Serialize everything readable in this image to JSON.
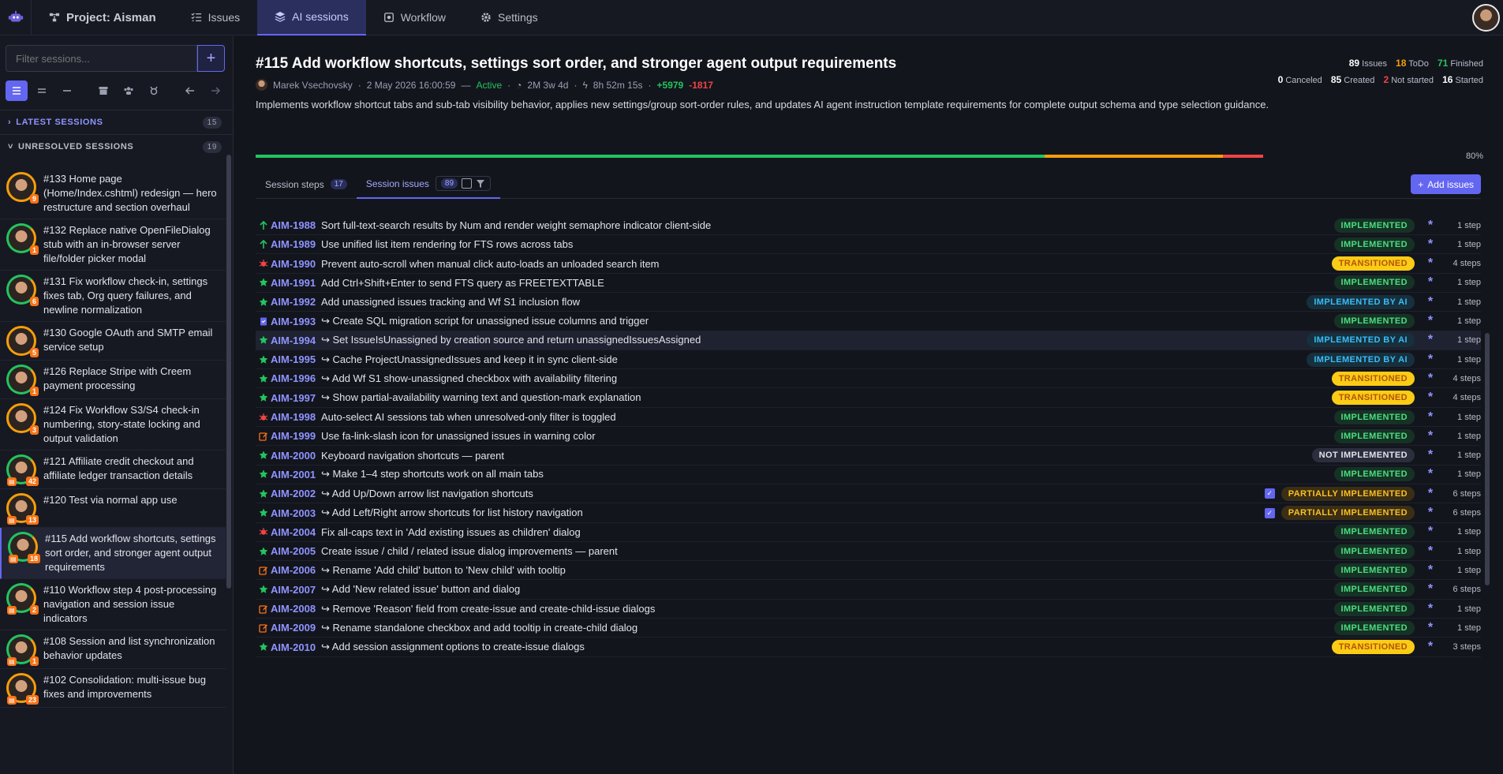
{
  "nav": {
    "project": "Project: Aisman",
    "issues": "Issues",
    "ai_sessions": "AI sessions",
    "workflow": "Workflow",
    "settings": "Settings"
  },
  "sidebar": {
    "filter_placeholder": "Filter sessions...",
    "add": "+",
    "latest_label": "LATEST SESSIONS",
    "latest_count": "15",
    "unresolved_label": "UNRESOLVED SESSIONS",
    "unresolved_count": "19",
    "sessions": [
      {
        "title": "#133 Home page (Home/Index.cshtml) redesign — hero restructure and section overhaul",
        "badge": "9"
      },
      {
        "title": "#132 Replace native OpenFileDialog stub with an in-browser server file/folder picker modal",
        "badge": "1"
      },
      {
        "title": "#131 Fix workflow check-in, settings fixes tab, Org query failures, and newline normalization",
        "badge": "6"
      },
      {
        "title": "#130 Google OAuth and SMTP email service setup",
        "badge": "5"
      },
      {
        "title": "#126 Replace Stripe with Creem payment processing",
        "badge": "1"
      },
      {
        "title": "#124 Fix Workflow S3/S4 check-in numbering, story-state locking and output validation",
        "badge": "3"
      },
      {
        "title": "#121 Affiliate credit checkout and affiliate ledger transaction details",
        "badge": "42"
      },
      {
        "title": "#120 Test via normal app use",
        "badge": "13"
      },
      {
        "title": "#115 Add workflow shortcuts, settings sort order, and stronger agent output requirements",
        "badge": "18"
      },
      {
        "title": "#110 Workflow step 4 post-processing navigation and session issue indicators",
        "badge": "2"
      },
      {
        "title": "#108 Session and list synchronization behavior updates",
        "badge": "1"
      },
      {
        "title": "#102 Consolidation: multi-issue bug fixes and improvements",
        "badge": "23"
      }
    ]
  },
  "session": {
    "title": "#115 Add workflow shortcuts, settings sort order, and stronger agent output requirements",
    "author": "Marek Vsechovsky",
    "date": "2 May 2026 16:00:59",
    "dash": "—",
    "status": "Active",
    "duration": "2M 3w 4d",
    "time": "8h 52m 15s",
    "added": "+5979",
    "removed": "-1817",
    "description": "Implements workflow shortcut tabs and sub-tab visibility behavior, applies new settings/group sort-order rules, and updates AI agent instruction template requirements for complete output schema and type selection guidance.",
    "progress_pct": "80%",
    "progress": {
      "implemented": 0.783,
      "partial": 0.177,
      "remaining": 0.04
    }
  },
  "stats": {
    "issues_n": "89",
    "issues_l": "Issues",
    "todo_n": "18",
    "todo_l": "ToDo",
    "finished_n": "71",
    "finished_l": "Finished",
    "canceled_n": "0",
    "canceled_l": "Canceled",
    "created_n": "85",
    "created_l": "Created",
    "notstarted_n": "2",
    "notstarted_l": "Not started",
    "started_n": "16",
    "started_l": "Started"
  },
  "tabs": {
    "steps": "Session steps",
    "steps_count": "17",
    "issues": "Session issues",
    "issues_count": "89",
    "add_issues": "Add issues"
  },
  "issues": [
    {
      "icon": "up",
      "id": "AIM-1988",
      "title": "Sort full-text-search results by Num and render weight semaphore indicator client-side",
      "status": "IMPLEMENTED",
      "kind": "impl",
      "steps": "1 step"
    },
    {
      "icon": "up",
      "id": "AIM-1989",
      "title": "Use unified list item rendering for FTS rows across tabs",
      "status": "IMPLEMENTED",
      "kind": "impl",
      "steps": "1 step"
    },
    {
      "icon": "bug",
      "id": "AIM-1990",
      "title": "Prevent auto-scroll when manual click auto-loads an unloaded search item",
      "status": "TRANSITIONED",
      "kind": "trans",
      "steps": "4 steps"
    },
    {
      "icon": "star",
      "id": "AIM-1991",
      "title": "Add Ctrl+Shift+Enter to send FTS query as FREETEXTTABLE",
      "status": "IMPLEMENTED",
      "kind": "impl",
      "steps": "1 step"
    },
    {
      "icon": "star",
      "id": "AIM-1992",
      "title": "Add unassigned issues tracking and Wf S1 inclusion flow",
      "status": "IMPLEMENTED BY AI",
      "kind": "ai",
      "steps": "1 step"
    },
    {
      "icon": "clip",
      "id": "AIM-1993",
      "title": "↪ Create SQL migration script for unassigned issue columns and trigger",
      "status": "IMPLEMENTED",
      "kind": "impl",
      "steps": "1 step"
    },
    {
      "icon": "star",
      "id": "AIM-1994",
      "title": "↪ Set IssueIsUnassigned by creation source and return unassignedIssuesAssigned",
      "status": "IMPLEMENTED BY AI",
      "kind": "ai",
      "steps": "1 step",
      "hl": true
    },
    {
      "icon": "star",
      "id": "AIM-1995",
      "title": "↪ Cache ProjectUnassignedIssues and keep it in sync client-side",
      "status": "IMPLEMENTED BY AI",
      "kind": "ai",
      "steps": "1 step"
    },
    {
      "icon": "star",
      "id": "AIM-1996",
      "title": "↪ Add Wf S1 show-unassigned checkbox with availability filtering",
      "status": "TRANSITIONED",
      "kind": "trans",
      "steps": "4 steps"
    },
    {
      "icon": "star",
      "id": "AIM-1997",
      "title": "↪ Show partial-availability warning text and question-mark explanation",
      "status": "TRANSITIONED",
      "kind": "trans",
      "steps": "4 steps"
    },
    {
      "icon": "bug",
      "id": "AIM-1998",
      "title": "Auto-select AI sessions tab when unresolved-only filter is toggled",
      "status": "IMPLEMENTED",
      "kind": "impl",
      "steps": "1 step"
    },
    {
      "icon": "edit",
      "id": "AIM-1999",
      "title": "Use fa-link-slash icon for unassigned issues in warning color",
      "status": "IMPLEMENTED",
      "kind": "impl",
      "steps": "1 step"
    },
    {
      "icon": "star",
      "id": "AIM-2000",
      "title": "Keyboard navigation shortcuts — parent",
      "status": "NOT IMPLEMENTED",
      "kind": "not",
      "steps": "1 step"
    },
    {
      "icon": "star",
      "id": "AIM-2001",
      "title": "↪ Make 1–4 step shortcuts work on all main tabs",
      "status": "IMPLEMENTED",
      "kind": "impl",
      "steps": "1 step"
    },
    {
      "icon": "star",
      "id": "AIM-2002",
      "title": "↪ Add Up/Down arrow list navigation shortcuts",
      "status": "PARTIALLY IMPLEMENTED",
      "kind": "part",
      "steps": "6 steps",
      "chk": true
    },
    {
      "icon": "star",
      "id": "AIM-2003",
      "title": "↪ Add Left/Right arrow shortcuts for list history navigation",
      "status": "PARTIALLY IMPLEMENTED",
      "kind": "part",
      "steps": "6 steps",
      "chk": true
    },
    {
      "icon": "bug",
      "id": "AIM-2004",
      "title": "Fix all-caps text in 'Add existing issues as children' dialog",
      "status": "IMPLEMENTED",
      "kind": "impl",
      "steps": "1 step"
    },
    {
      "icon": "star",
      "id": "AIM-2005",
      "title": "Create issue / child / related issue dialog improvements — parent",
      "status": "IMPLEMENTED",
      "kind": "impl",
      "steps": "1 step"
    },
    {
      "icon": "edit",
      "id": "AIM-2006",
      "title": "↪ Rename 'Add child' button to 'New child' with tooltip",
      "status": "IMPLEMENTED",
      "kind": "impl",
      "steps": "1 step"
    },
    {
      "icon": "star",
      "id": "AIM-2007",
      "title": "↪ Add 'New related issue' button and dialog",
      "status": "IMPLEMENTED",
      "kind": "impl",
      "steps": "6 steps"
    },
    {
      "icon": "edit",
      "id": "AIM-2008",
      "title": "↪ Remove 'Reason' field from create-issue and create-child-issue dialogs",
      "status": "IMPLEMENTED",
      "kind": "impl",
      "steps": "1 step"
    },
    {
      "icon": "edit",
      "id": "AIM-2009",
      "title": "↪ Rename standalone checkbox and add tooltip in create-child dialog",
      "status": "IMPLEMENTED",
      "kind": "impl",
      "steps": "1 step"
    },
    {
      "icon": "star",
      "id": "AIM-2010",
      "title": "↪ Add session assignment options to create-issue dialogs",
      "status": "TRANSITIONED",
      "kind": "trans",
      "steps": "3 steps"
    }
  ],
  "colors": {
    "accent": "#6366f1",
    "green": "#22c55e",
    "orange": "#f59e0b",
    "red": "#ef4444"
  }
}
